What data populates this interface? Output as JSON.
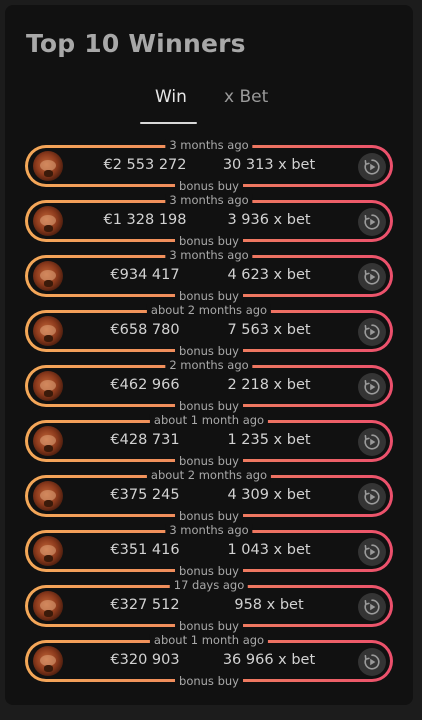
{
  "title": "Top 10 Winners",
  "tabs": [
    {
      "label": "Win",
      "active": true
    },
    {
      "label": "x Bet",
      "active": false
    }
  ],
  "winners": [
    {
      "time": "3 months ago",
      "amount": "€2 553 272",
      "multiplier": "30 313 x bet",
      "type": "bonus buy"
    },
    {
      "time": "3 months ago",
      "amount": "€1 328 198",
      "multiplier": "3 936 x bet",
      "type": "bonus buy"
    },
    {
      "time": "3 months ago",
      "amount": "€934 417",
      "multiplier": "4 623 x bet",
      "type": "bonus buy"
    },
    {
      "time": "about 2 months ago",
      "amount": "€658 780",
      "multiplier": "7 563 x bet",
      "type": "bonus buy"
    },
    {
      "time": "2 months ago",
      "amount": "€462 966",
      "multiplier": "2 218 x bet",
      "type": "bonus buy"
    },
    {
      "time": "about 1 month ago",
      "amount": "€428 731",
      "multiplier": "1 235 x bet",
      "type": "bonus buy"
    },
    {
      "time": "about 2 months ago",
      "amount": "€375 245",
      "multiplier": "4 309 x bet",
      "type": "bonus buy"
    },
    {
      "time": "3 months ago",
      "amount": "€351 416",
      "multiplier": "1 043 x bet",
      "type": "bonus buy"
    },
    {
      "time": "17 days ago",
      "amount": "€327 512",
      "multiplier": "958 x bet",
      "type": "bonus buy"
    },
    {
      "time": "about 1 month ago",
      "amount": "€320 903",
      "multiplier": "36 966 x bet",
      "type": "bonus buy"
    }
  ],
  "icons": {
    "avatar": "game-thumbnail-icon",
    "replay": "replay-play-icon"
  },
  "colors": {
    "gradient_start": "#f4a858",
    "gradient_end": "#ec4f6c",
    "background": "#111111"
  }
}
